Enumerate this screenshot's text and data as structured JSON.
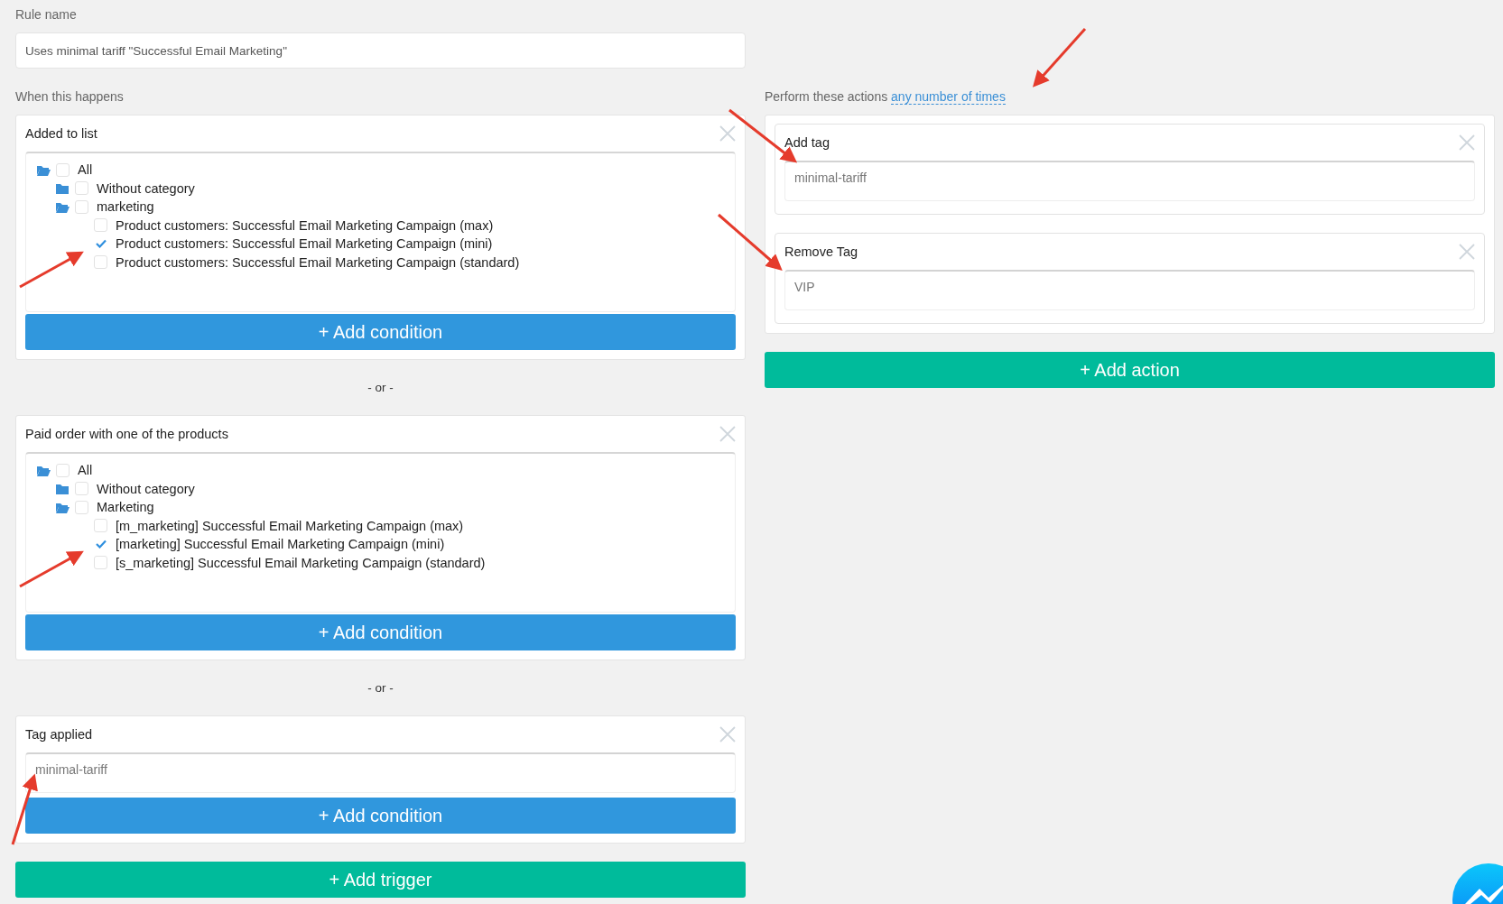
{
  "rule_name": {
    "label": "Rule name",
    "value": "Uses minimal tariff \"Successful Email Marketing\""
  },
  "triggers_label": "When this happens",
  "triggers": [
    {
      "kind": "tree",
      "title": "Added to list",
      "button": "+ Add condition",
      "tree": [
        {
          "kind": "folder",
          "label": "All",
          "expanded": true,
          "checked": false,
          "children": [
            {
              "kind": "folder",
              "label": "Without category",
              "expanded": false,
              "checked": false
            },
            {
              "kind": "folder",
              "label": "marketing",
              "expanded": true,
              "checked": false,
              "children": [
                {
                  "kind": "item",
                  "label": "Product customers: Successful Email Marketing Campaign (max)",
                  "checked": false
                },
                {
                  "kind": "item",
                  "label": "Product customers: Successful Email Marketing Campaign (mini)",
                  "checked": true
                },
                {
                  "kind": "item",
                  "label": "Product customers: Successful Email Marketing Campaign (standard)",
                  "checked": false
                }
              ]
            }
          ]
        }
      ]
    },
    {
      "kind": "tree",
      "title": "Paid order with one of the products",
      "button": "+ Add condition",
      "tree": [
        {
          "kind": "folder",
          "label": "All",
          "expanded": true,
          "checked": false,
          "children": [
            {
              "kind": "folder",
              "label": "Without category",
              "expanded": false,
              "checked": false
            },
            {
              "kind": "folder",
              "label": "Marketing",
              "expanded": true,
              "checked": false,
              "children": [
                {
                  "kind": "item",
                  "label": "[m_marketing] Successful Email Marketing Campaign (max)",
                  "checked": false
                },
                {
                  "kind": "item",
                  "label": "[marketing] Successful Email Marketing Campaign (mini)",
                  "checked": true
                },
                {
                  "kind": "item",
                  "label": "[s_marketing] Successful Email Marketing Campaign (standard)",
                  "checked": false
                }
              ]
            }
          ]
        }
      ]
    },
    {
      "kind": "tag",
      "title": "Tag applied",
      "value": "minimal-tariff",
      "button": "+ Add condition"
    }
  ],
  "separators": [
    "- or -",
    "- or -"
  ],
  "add_trigger": "+ Add trigger",
  "actions": {
    "label": "Perform these actions",
    "link": "any number of times",
    "items": [
      {
        "title": "Add tag",
        "value": "minimal-tariff"
      },
      {
        "title": "Remove Tag",
        "value": "VIP"
      }
    ],
    "button": "+ Add action"
  }
}
